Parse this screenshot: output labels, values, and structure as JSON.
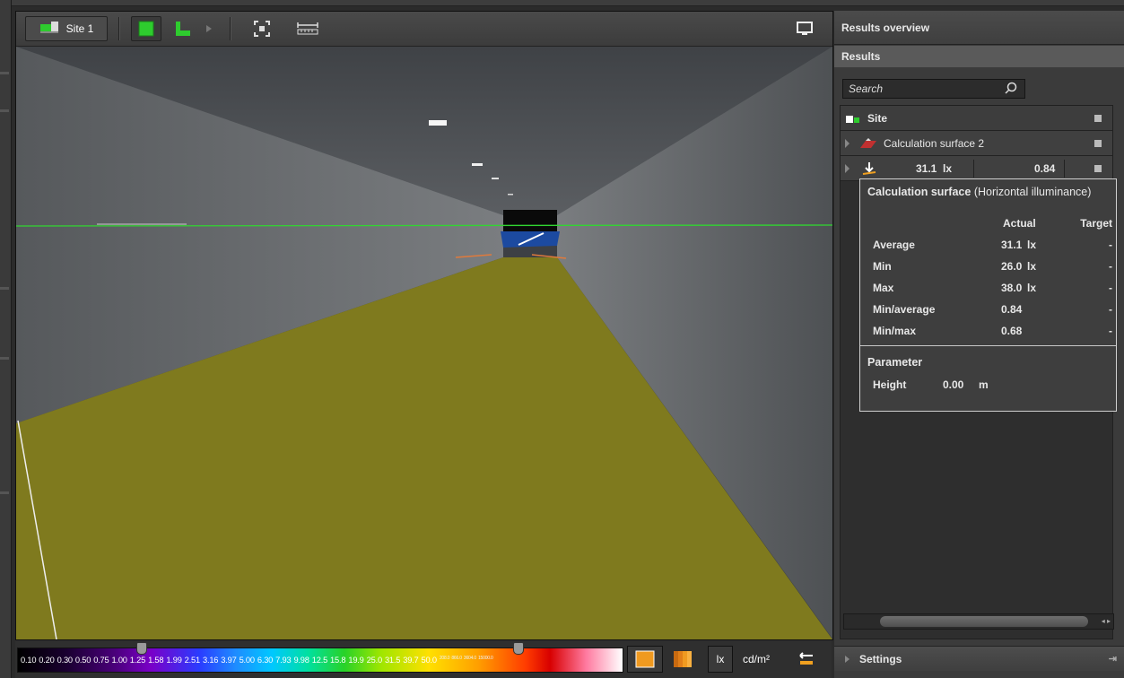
{
  "toolbar": {
    "site_label": "Site 1"
  },
  "scale": {
    "labels": [
      "0.10",
      "0.20",
      "0.30",
      "0.50",
      "0.75",
      "1.00",
      "1.25",
      "1.58",
      "1.99",
      "2.51",
      "3.16",
      "3.97",
      "5.00",
      "6.30",
      "7.93",
      "9.98",
      "12.5",
      "15.8",
      "19.9",
      "25.0",
      "31.5",
      "39.7",
      "50.0"
    ],
    "tiny_labels": [
      "208.0",
      "866.0",
      "3604.0",
      "15000.0"
    ],
    "unit_lux": "lx",
    "unit_luminance": "cd/m²",
    "lower_thumb_fraction": 0.205,
    "upper_thumb_fraction": 0.827
  },
  "panel": {
    "title": "Results overview",
    "subtitle": "Results",
    "search_placeholder": "Search",
    "tree": {
      "site": "Site",
      "calc_surface": "Calculation surface 2",
      "value": "31.1",
      "value_unit": "lx",
      "ratio": "0.84"
    },
    "tooltip": {
      "title_bold": "Calculation surface",
      "title_rest": "(Horizontal illuminance)",
      "col_actual": "Actual",
      "col_target": "Target",
      "rows": [
        {
          "label": "Average",
          "value": "31.1",
          "unit": "lx",
          "target": "-"
        },
        {
          "label": "Min",
          "value": "26.0",
          "unit": "lx",
          "target": "-"
        },
        {
          "label": "Max",
          "value": "38.0",
          "unit": "lx",
          "target": "-"
        },
        {
          "label": "Min/average",
          "value": "0.84",
          "unit": "",
          "target": "-"
        },
        {
          "label": "Min/max",
          "value": "0.68",
          "unit": "",
          "target": "-"
        }
      ],
      "param_heading": "Parameter",
      "param_label": "Height",
      "param_value": "0.00",
      "param_unit": "m"
    },
    "settings_label": "Settings"
  },
  "colors": {
    "floor": "#7f7a1e",
    "accent_green": "#2ecc2e",
    "accent_orange": "#f0a020"
  }
}
